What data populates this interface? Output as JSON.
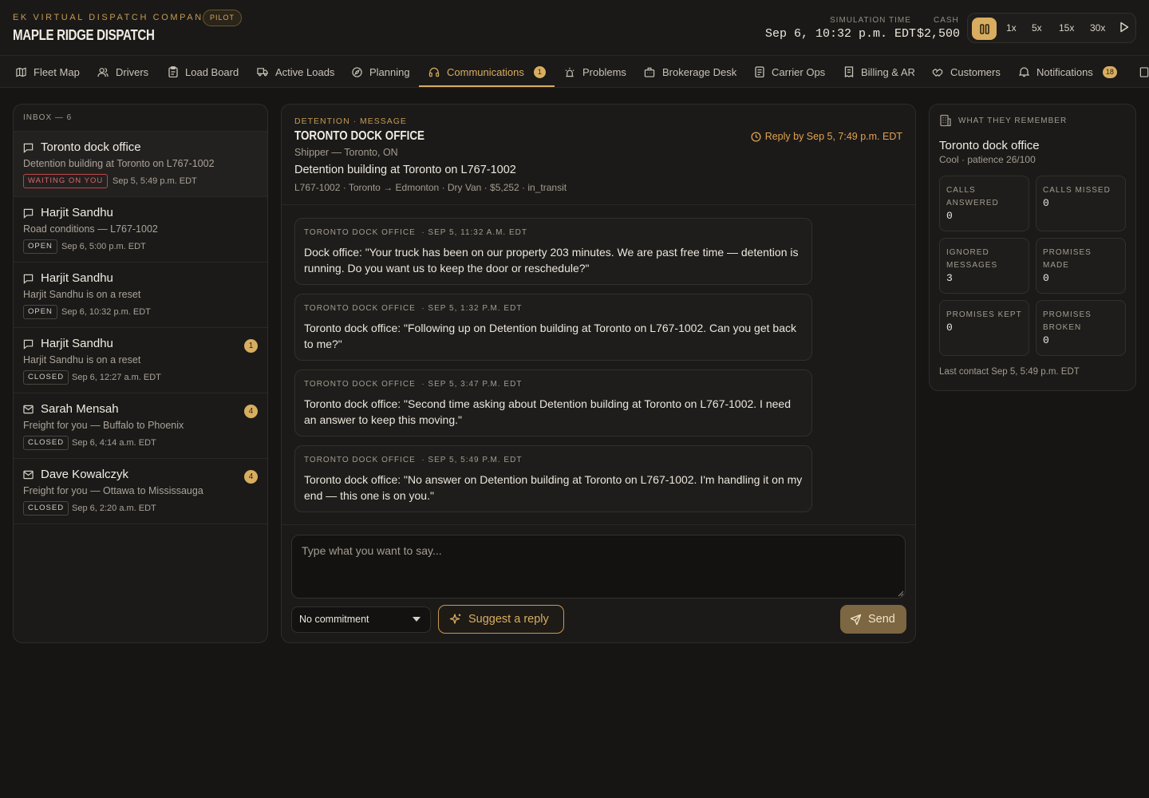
{
  "header": {
    "company": "EK VIRTUAL DISPATCH COMPANY",
    "mode_badge": "PILOT",
    "brand": "MAPLE RIDGE DISPATCH",
    "simulation_time_label": "SIMULATION TIME",
    "simulation_time": "Sep 6, 10:32 p.m. EDT",
    "cash_label": "CASH",
    "cash": "$2,500",
    "speed_options": [
      "1x",
      "5x",
      "15x",
      "30x"
    ],
    "paused": true
  },
  "nav": {
    "tabs": [
      {
        "label": "Fleet Map",
        "icon": "map-icon"
      },
      {
        "label": "Drivers",
        "icon": "users-icon"
      },
      {
        "label": "Load Board",
        "icon": "clipboard-icon"
      },
      {
        "label": "Active Loads",
        "icon": "truck-icon"
      },
      {
        "label": "Planning",
        "icon": "compass-icon"
      },
      {
        "label": "Communications",
        "icon": "headset-icon",
        "badge": "1",
        "active": true
      },
      {
        "label": "Problems",
        "icon": "siren-icon"
      },
      {
        "label": "Brokerage Desk",
        "icon": "building-icon"
      },
      {
        "label": "Carrier Ops",
        "icon": "clipboard-list-icon"
      },
      {
        "label": "Billing & AR",
        "icon": "receipt-icon"
      },
      {
        "label": "Customers",
        "icon": "handshake-icon"
      },
      {
        "label": "Notifications",
        "icon": "bell-icon",
        "badge": "18"
      }
    ]
  },
  "inbox": {
    "header": "INBOX — 6",
    "items": [
      {
        "name": "Toronto dock office",
        "subject": "Detention building at Toronto on L767-1002",
        "status": "WAITING ON YOU",
        "time": "Sep 5, 5:49 p.m. EDT",
        "icon": "message-icon",
        "count": ""
      },
      {
        "name": "Harjit Sandhu",
        "subject": "Road conditions — L767-1002",
        "status": "OPEN",
        "time": "Sep 6, 5:00 p.m. EDT",
        "icon": "message-icon",
        "count": ""
      },
      {
        "name": "Harjit Sandhu",
        "subject": "Harjit Sandhu is on a reset",
        "status": "OPEN",
        "time": "Sep 6, 10:32 p.m. EDT",
        "icon": "message-icon",
        "count": ""
      },
      {
        "name": "Harjit Sandhu",
        "subject": "Harjit Sandhu is on a reset",
        "status": "CLOSED",
        "time": "Sep 6, 12:27 a.m. EDT",
        "icon": "message-icon",
        "count": "1"
      },
      {
        "name": "Sarah Mensah",
        "subject": "Freight for you — Buffalo to Phoenix",
        "status": "CLOSED",
        "time": "Sep 6, 4:14 a.m. EDT",
        "icon": "mail-icon",
        "count": "4"
      },
      {
        "name": "Dave Kowalczyk",
        "subject": "Freight for you — Ottawa to Mississauga",
        "status": "CLOSED",
        "time": "Sep 6, 2:20 a.m. EDT",
        "icon": "mail-icon",
        "count": "4"
      }
    ]
  },
  "thread": {
    "category": "DETENTION · MESSAGE",
    "title": "TORONTO DOCK OFFICE",
    "role": "Shipper — Toronto, ON",
    "reply_by": "Reply by Sep 5, 7:49 p.m. EDT",
    "subject": "Detention building at Toronto on L767-1002",
    "meta": "L767-1002 · Toronto → Edmonton · Dry Van · $5,252 · in_transit",
    "messages": [
      {
        "from": "TORONTO DOCK OFFICE",
        "time": "· SEP 5, 11:32 A.M. EDT",
        "text": "Dock office: \"Your truck has been on our property 203 minutes. We are past free time — detention is running. Do you want us to keep the door or reschedule?\""
      },
      {
        "from": "TORONTO DOCK OFFICE",
        "time": "· SEP 5, 1:32 P.M. EDT",
        "text": "Toronto dock office: \"Following up on Detention building at Toronto on L767-1002. Can you get back to me?\""
      },
      {
        "from": "TORONTO DOCK OFFICE",
        "time": "· SEP 5, 3:47 P.M. EDT",
        "text": "Toronto dock office: \"Second time asking about Detention building at Toronto on L767-1002. I need an answer to keep this moving.\""
      },
      {
        "from": "TORONTO DOCK OFFICE",
        "time": "· SEP 5, 5:49 P.M. EDT",
        "text": "Toronto dock office: \"No answer on Detention building at Toronto on L767-1002. I'm handling it on my end — this one is on you.\""
      }
    ]
  },
  "composer": {
    "placeholder": "Type what you want to say...",
    "value": "",
    "commitment": "No commitment",
    "suggest_label": "Suggest a reply",
    "send_label": "Send"
  },
  "memory": {
    "header": "WHAT THEY REMEMBER",
    "name": "Toronto dock office",
    "temperament": "Cool · patience 26/100",
    "stats": [
      {
        "label": "CALLS ANSWERED",
        "value": "0"
      },
      {
        "label": "CALLS MISSED",
        "value": "0"
      },
      {
        "label": "IGNORED MESSAGES",
        "value": "3"
      },
      {
        "label": "PROMISES MADE",
        "value": "0"
      },
      {
        "label": "PROMISES KEPT",
        "value": "0"
      },
      {
        "label": "PROMISES BROKEN",
        "value": "0"
      }
    ],
    "last_contact": "Last contact Sep 5, 5:49 p.m. EDT"
  },
  "colors": {
    "accent": "#d8ad60",
    "warning": "#d56a6a",
    "background": "#161514",
    "panel": "#1b1a19"
  }
}
